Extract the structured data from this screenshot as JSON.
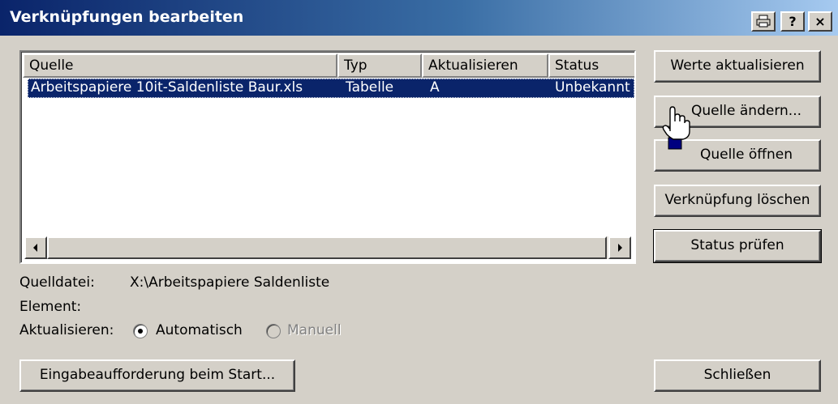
{
  "window": {
    "title": "Verknüpfungen bearbeiten",
    "help_button": "?",
    "close_button": "×"
  },
  "list": {
    "columns": [
      "Quelle",
      "Typ",
      "Aktualisieren",
      "Status"
    ],
    "rows": [
      {
        "quelle": "Arbeitspapiere 10it-Saldenliste Baur.xls",
        "typ": "Tabelle",
        "aktualisieren": "A",
        "status": "Unbekannt"
      }
    ]
  },
  "buttons": {
    "werte_aktualisieren": "Werte aktualisieren",
    "quelle_aendern": "Quelle ändern...",
    "quelle_oeffnen": "Quelle öffnen",
    "verknuepfung_loeschen": "Verknüpfung löschen",
    "status_pruefen": "Status prüfen",
    "eingabeaufforderung": "Eingabeaufforderung beim Start...",
    "schliessen": "Schließen"
  },
  "details": {
    "quelldatei_label": "Quelldatei:",
    "quelldatei_value": "X:\\Arbeitspapiere Saldenliste",
    "element_label": "Element:",
    "aktualisieren_label": "Aktualisieren:",
    "automatisch_label": "Automatisch",
    "manuell_label": "Manuell",
    "selected_update_mode": "Automatisch"
  },
  "colors": {
    "titlebar_start": "#0a246a",
    "titlebar_end": "#a6caf0",
    "selection": "#0a246a",
    "face": "#d4d0c8"
  }
}
